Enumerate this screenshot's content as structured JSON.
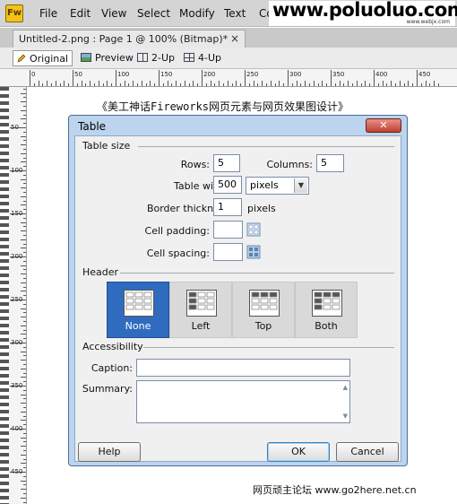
{
  "app": {
    "logo": "Fw",
    "menu": [
      "File",
      "Edit",
      "View",
      "Select",
      "Modify",
      "Text",
      "Co"
    ]
  },
  "watermark": {
    "text": "www.poluoluo.com",
    "sub": "www.webjx.com"
  },
  "document": {
    "tab_label": "Untitled-2.png : Page 1 @ 100% (Bitmap)*",
    "close_glyph": "×"
  },
  "view": {
    "buttons": [
      "Original",
      "Preview",
      "2-Up",
      "4-Up"
    ],
    "active": "Original"
  },
  "ruler": {
    "h_labels": [
      "0",
      "50",
      "100",
      "150",
      "200",
      "250",
      "300",
      "350",
      "400",
      "450"
    ],
    "v_labels": [
      "50",
      "100",
      "150",
      "200",
      "250",
      "300",
      "350",
      "400",
      "450"
    ]
  },
  "caption_title": "《美工神话Fireworks网页元素与网页效果图设计》",
  "dialog": {
    "title": "Table",
    "table_size": {
      "label": "Table size",
      "rows_label": "Rows:",
      "rows": "5",
      "columns_label": "Columns:",
      "columns": "5",
      "width_label": "Table width:",
      "width": "500",
      "width_unit": "pixels",
      "border_label": "Border thickness:",
      "border": "1",
      "border_unit": "pixels",
      "padding_label": "Cell padding:",
      "padding": "",
      "spacing_label": "Cell spacing:",
      "spacing": ""
    },
    "header": {
      "label": "Header",
      "options": [
        "None",
        "Left",
        "Top",
        "Both"
      ],
      "selected": "None"
    },
    "accessibility": {
      "label": "Accessibility",
      "caption_label": "Caption:",
      "caption": "",
      "summary_label": "Summary:",
      "summary": ""
    },
    "buttons": {
      "help": "Help",
      "ok": "OK",
      "cancel": "Cancel"
    }
  },
  "footer": "网页顽主论坛 www.go2here.net.cn",
  "colors": {
    "selected_header": "#2f6cc0",
    "dialog_frame": "#bcd4ee",
    "close_button": "#c2402f",
    "logo": "#f3c21b"
  }
}
